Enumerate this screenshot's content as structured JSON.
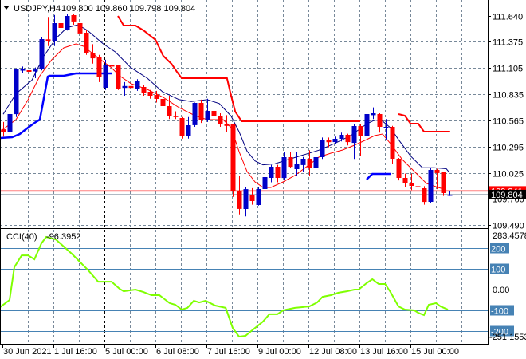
{
  "header": {
    "symbol": "USDJPY,H4",
    "ohlc": "109.800 109.860 109.798 109.804"
  },
  "colors": {
    "bull": "#0000C8",
    "bear": "#FF0000",
    "upper_band": "#000080",
    "ma": "#FF0000",
    "stop_red": "#FF0000",
    "stop_blue": "#0000FF",
    "cci": "#7FFF00",
    "level": "#4682B4",
    "grid": "#778899"
  },
  "chart_data": [
    {
      "type": "candlestick",
      "title": "USDJPY,H4",
      "price_ticks": [
        "111.640",
        "111.375",
        "111.105",
        "110.835",
        "110.565",
        "110.295",
        "110.025",
        "109.760",
        "109.490"
      ],
      "ylim": [
        109.49,
        111.64
      ],
      "bid_label": "109.841",
      "current_label": "109.804",
      "bid": 109.841,
      "current": 109.804,
      "time_labels": [
        "30 Jun 2021",
        "1 Jul 16:00",
        "5 Jul 00:00",
        "6 Jul 08:00",
        "7 Jul 16:00",
        "9 Jul 00:00",
        "12 Jul 08:00",
        "13 Jul 16:00",
        "15 Jul 00:00"
      ],
      "candles_ohlc": [
        [
          110.475,
          110.55,
          110.4,
          110.45
        ],
        [
          110.451,
          110.66,
          110.43,
          110.631
        ],
        [
          110.631,
          111.1,
          110.6,
          111.091
        ],
        [
          111.082,
          111.12,
          111.05,
          111.091
        ],
        [
          111.082,
          111.14,
          111.03,
          111.066
        ],
        [
          111.07,
          111.11,
          111.0,
          111.09
        ],
        [
          111.091,
          111.42,
          111.08,
          111.402
        ],
        [
          111.4,
          111.63,
          111.33,
          111.385
        ],
        [
          111.378,
          111.65,
          111.33,
          111.566
        ],
        [
          111.566,
          111.65,
          111.51,
          111.517
        ],
        [
          111.501,
          111.66,
          111.49,
          111.64
        ],
        [
          111.648,
          111.66,
          111.55,
          111.583
        ],
        [
          111.566,
          111.66,
          111.42,
          111.46
        ],
        [
          111.468,
          111.5,
          111.24,
          111.255
        ],
        [
          111.263,
          111.35,
          111.15,
          111.205
        ],
        [
          111.222,
          111.24,
          110.96,
          111.009
        ],
        [
          110.902,
          111.19,
          110.88,
          111.14
        ],
        [
          111.14,
          111.15,
          111.08,
          111.12
        ],
        [
          111.132,
          111.14,
          110.88,
          110.886
        ],
        [
          110.9,
          110.96,
          110.82,
          110.92
        ],
        [
          110.92,
          110.96,
          110.87,
          110.9
        ],
        [
          110.886,
          110.99,
          110.87,
          110.976
        ],
        [
          110.91,
          110.93,
          110.82,
          110.853
        ],
        [
          110.861,
          110.88,
          110.79,
          110.82
        ],
        [
          110.828,
          110.87,
          110.75,
          110.787
        ],
        [
          110.787,
          110.82,
          110.66,
          110.713
        ],
        [
          110.713,
          110.82,
          110.58,
          110.615
        ],
        [
          110.615,
          110.66,
          110.58,
          110.6
        ],
        [
          110.59,
          110.6,
          110.38,
          110.402
        ],
        [
          110.402,
          110.6,
          110.38,
          110.517
        ],
        [
          110.517,
          110.75,
          110.5,
          110.746
        ],
        [
          110.746,
          110.78,
          110.54,
          110.574
        ],
        [
          110.566,
          110.79,
          110.55,
          110.664
        ],
        [
          110.664,
          110.7,
          110.54,
          110.607
        ],
        [
          110.607,
          110.64,
          110.5,
          110.525
        ],
        [
          110.53,
          110.62,
          110.45,
          110.51
        ],
        [
          110.525,
          110.53,
          109.78,
          109.836
        ],
        [
          109.844,
          110.0,
          109.6,
          109.656
        ],
        [
          109.656,
          109.88,
          109.58,
          109.86
        ],
        [
          109.795,
          109.87,
          109.7,
          109.738
        ],
        [
          109.697,
          109.88,
          109.69,
          109.861
        ],
        [
          109.861,
          109.99,
          109.8,
          109.984
        ],
        [
          109.975,
          110.11,
          109.93,
          110.09
        ],
        [
          110.09,
          110.11,
          109.93,
          109.975
        ],
        [
          109.975,
          110.24,
          109.95,
          110.189
        ],
        [
          110.189,
          110.24,
          110.08,
          110.09
        ],
        [
          110.066,
          110.24,
          110.0,
          110.115
        ],
        [
          110.107,
          110.19,
          110.04,
          110.172
        ],
        [
          110.172,
          110.26,
          110.0,
          110.074
        ],
        [
          110.074,
          110.22,
          110.04,
          110.189
        ],
        [
          110.189,
          110.39,
          110.17,
          110.369
        ],
        [
          110.369,
          110.39,
          110.29,
          110.343
        ],
        [
          110.343,
          110.4,
          110.32,
          110.377
        ],
        [
          110.377,
          110.44,
          110.35,
          110.418
        ],
        [
          110.418,
          110.43,
          110.31,
          110.343
        ],
        [
          110.335,
          110.53,
          110.17,
          110.508
        ],
        [
          110.508,
          110.53,
          110.2,
          110.402
        ],
        [
          110.41,
          110.64,
          110.38,
          110.631
        ],
        [
          110.62,
          110.7,
          110.58,
          110.64
        ],
        [
          110.631,
          110.64,
          110.44,
          110.5
        ],
        [
          110.49,
          110.58,
          110.37,
          110.5
        ],
        [
          110.5,
          110.51,
          110.12,
          110.172
        ],
        [
          110.172,
          110.18,
          109.95,
          109.975
        ],
        [
          109.975,
          110.02,
          109.88,
          109.926
        ],
        [
          109.918,
          110.02,
          109.85,
          109.893
        ],
        [
          109.89,
          110.0,
          109.85,
          109.88
        ],
        [
          109.869,
          109.89,
          109.7,
          109.729
        ],
        [
          109.729,
          110.08,
          109.72,
          110.057
        ],
        [
          110.057,
          110.07,
          109.86,
          110.025
        ],
        [
          110.033,
          110.04,
          109.79,
          109.82
        ],
        [
          109.8,
          109.84,
          109.79,
          109.804
        ]
      ],
      "upper_band": [
        [
          0,
          110.63
        ],
        [
          2,
          110.84
        ],
        [
          4.5,
          110.98
        ],
        [
          6.4,
          111.23
        ],
        [
          8.3,
          111.41
        ],
        [
          10,
          111.52
        ],
        [
          11.75,
          111.55
        ],
        [
          13.25,
          111.49
        ],
        [
          15.75,
          111.35
        ],
        [
          17.6,
          111.27
        ],
        [
          20,
          111.11
        ],
        [
          22.6,
          111.0
        ],
        [
          25,
          110.86
        ],
        [
          27.6,
          110.78
        ],
        [
          29.5,
          110.76
        ],
        [
          32,
          110.78
        ],
        [
          33.9,
          110.74
        ],
        [
          35.75,
          110.61
        ],
        [
          37,
          110.45
        ],
        [
          38.25,
          110.25
        ],
        [
          39.5,
          110.15
        ],
        [
          40.75,
          110.11
        ],
        [
          42.6,
          110.12
        ],
        [
          44.5,
          110.16
        ],
        [
          47,
          110.21
        ],
        [
          49.5,
          110.26
        ],
        [
          52,
          110.33
        ],
        [
          54.5,
          110.41
        ],
        [
          57,
          110.53
        ],
        [
          58.25,
          110.57
        ],
        [
          59.5,
          110.56
        ],
        [
          60.75,
          110.49
        ],
        [
          62,
          110.37
        ],
        [
          63.9,
          110.2
        ],
        [
          65.75,
          110.08
        ],
        [
          67.6,
          110.08
        ],
        [
          69.5,
          110.07
        ],
        [
          70,
          110.03
        ]
      ],
      "moving_average": [
        [
          -0.5,
          110.451
        ],
        [
          2,
          110.574
        ],
        [
          3.9,
          110.779
        ],
        [
          5.75,
          111.025
        ],
        [
          7.6,
          111.189
        ],
        [
          9.5,
          111.312
        ],
        [
          11.4,
          111.353
        ],
        [
          12.6,
          111.328
        ],
        [
          14.5,
          111.23
        ],
        [
          17,
          111.107
        ],
        [
          18.25,
          111.025
        ],
        [
          20.1,
          110.943
        ],
        [
          22.6,
          110.886
        ],
        [
          25.1,
          110.804
        ],
        [
          27.6,
          110.697
        ],
        [
          30.1,
          110.615
        ],
        [
          32,
          110.574
        ],
        [
          34.5,
          110.574
        ],
        [
          35.75,
          110.492
        ],
        [
          37,
          110.246
        ],
        [
          38.25,
          110.041
        ],
        [
          39.5,
          109.934
        ],
        [
          40.75,
          109.877
        ],
        [
          42,
          109.877
        ],
        [
          43.9,
          109.934
        ],
        [
          45.75,
          110.0
        ],
        [
          48.25,
          110.123
        ],
        [
          49.5,
          110.189
        ],
        [
          51.4,
          110.23
        ],
        [
          53.25,
          110.262
        ],
        [
          55.1,
          110.312
        ],
        [
          57,
          110.369
        ],
        [
          58.25,
          110.41
        ],
        [
          59.5,
          110.426
        ],
        [
          60.75,
          110.328
        ],
        [
          62.6,
          110.164
        ],
        [
          64.5,
          110.041
        ],
        [
          66.4,
          109.918
        ],
        [
          68.25,
          109.877
        ],
        [
          69.5,
          109.852
        ]
      ],
      "stop_line_red": [
        [
          [
            18,
            111.64
          ],
          [
            18.9,
            111.542
          ],
          [
            20.75,
            111.542
          ],
          [
            22,
            111.492
          ],
          [
            23.9,
            111.394
          ],
          [
            25.1,
            111.23
          ],
          [
            26.4,
            111.148
          ],
          [
            27.25,
            111.066
          ],
          [
            28,
            111.0
          ],
          [
            35.1,
            111.0
          ],
          [
            35.75,
            110.82
          ],
          [
            36.4,
            110.656
          ],
          [
            37.4,
            110.558
          ],
          [
            56,
            110.558
          ]
        ],
        [
          [
            62,
            110.631
          ],
          [
            63,
            110.615
          ],
          [
            63.9,
            110.533
          ],
          [
            65.1,
            110.533
          ],
          [
            66,
            110.451
          ],
          [
            70.1,
            110.451
          ]
        ]
      ],
      "stop_line_blue": [
        [
          [
            -0.5,
            110.385
          ],
          [
            1.4,
            110.394
          ],
          [
            2.6,
            110.426
          ],
          [
            3.9,
            110.492
          ],
          [
            5.1,
            110.549
          ],
          [
            5.75,
            110.574
          ],
          [
            7,
            111.017
          ],
          [
            7.25,
            111.025
          ],
          [
            9.5,
            111.025
          ],
          [
            11.4,
            111.05
          ],
          [
            17,
            111.05
          ]
        ],
        [
          [
            57,
            109.959
          ],
          [
            57.9,
            110.016
          ],
          [
            60.75,
            110.016
          ]
        ]
      ]
    },
    {
      "type": "line",
      "title": "CCI(40)",
      "value_label": "-96.3952",
      "ylim": [
        -251.1553,
        283.4578
      ],
      "max_label": "283.4578",
      "min_label": "-251.1553",
      "levels": [
        200,
        100,
        -100,
        -200
      ],
      "level_labels": [
        "200",
        "100",
        "-100",
        "-200"
      ],
      "zero_label": "0.00",
      "points": [
        [
          -0.5,
          -85
        ],
        [
          1,
          -50
        ],
        [
          1.75,
          108
        ],
        [
          2.9,
          165
        ],
        [
          3.9,
          165
        ],
        [
          4.9,
          146
        ],
        [
          6,
          223
        ],
        [
          6.75,
          254
        ],
        [
          8.25,
          242
        ],
        [
          10.75,
          173
        ],
        [
          13.25,
          96
        ],
        [
          14.9,
          38
        ],
        [
          17,
          38
        ],
        [
          18.25,
          4
        ],
        [
          18.9,
          -8
        ],
        [
          20.75,
          0
        ],
        [
          22,
          -12
        ],
        [
          23.25,
          -27
        ],
        [
          24.5,
          -27
        ],
        [
          26.1,
          -65
        ],
        [
          27,
          -73
        ],
        [
          28,
          -96
        ],
        [
          28.9,
          -88
        ],
        [
          29.9,
          -54
        ],
        [
          30.75,
          -62
        ],
        [
          31.75,
          -54
        ],
        [
          33.25,
          -77
        ],
        [
          34.9,
          -88
        ],
        [
          36,
          -185
        ],
        [
          37,
          -227
        ],
        [
          38,
          -223
        ],
        [
          38.9,
          -200
        ],
        [
          40.75,
          -154
        ],
        [
          41.75,
          -119
        ],
        [
          43,
          -119
        ],
        [
          43.9,
          -100
        ],
        [
          45.75,
          -88
        ],
        [
          48,
          -81
        ],
        [
          49.25,
          -62
        ],
        [
          50.1,
          -35
        ],
        [
          51.4,
          -27
        ],
        [
          52.6,
          -15
        ],
        [
          53.9,
          -8
        ],
        [
          55.1,
          0
        ],
        [
          55.75,
          0
        ],
        [
          57,
          31
        ],
        [
          57.9,
          50
        ],
        [
          58.9,
          27
        ],
        [
          59.9,
          27
        ],
        [
          60.75,
          -12
        ],
        [
          62,
          -81
        ],
        [
          63,
          -96
        ],
        [
          64.5,
          -100
        ],
        [
          65.1,
          -112
        ],
        [
          66,
          -123
        ],
        [
          66.75,
          -73
        ],
        [
          67.9,
          -65
        ],
        [
          68.6,
          -81
        ],
        [
          69.75,
          -96
        ]
      ]
    }
  ]
}
